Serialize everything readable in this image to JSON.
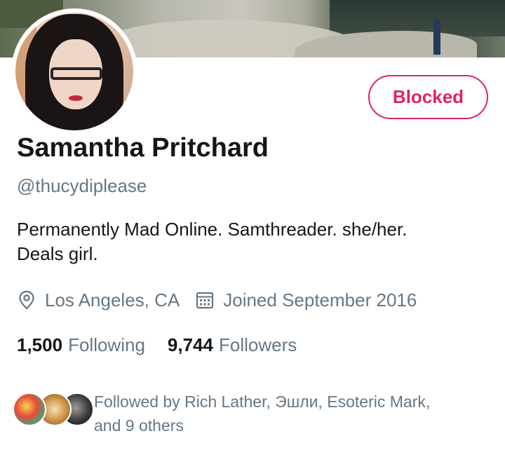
{
  "profile": {
    "name": "Samantha Pritchard",
    "handle": "@thucydiplease",
    "bio_line1": "Permanently Mad Online. Samthreader. she/her.",
    "bio_line2": "Deals girl.",
    "location": "Los Angeles, CA",
    "joined": "Joined September 2016",
    "location_icon": "location-pin-icon",
    "calendar_icon": "calendar-icon"
  },
  "actions": {
    "blocked_label": "Blocked"
  },
  "stats": {
    "following_count": "1,500",
    "following_label": "Following",
    "followers_count": "9,744",
    "followers_label": "Followers"
  },
  "followed_by": {
    "line1": "Followed by Rich Lather, Эшли, Esoteric Mark,",
    "line2": "and 9 others"
  },
  "colors": {
    "accent": "#e0245e",
    "secondary_text": "#657786",
    "primary_text": "#14171a"
  }
}
